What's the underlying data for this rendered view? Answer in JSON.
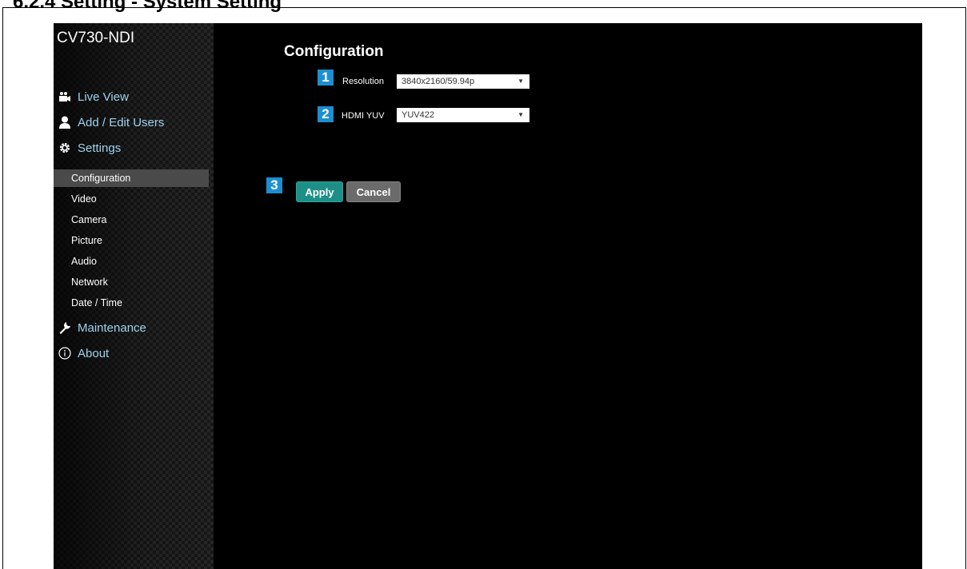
{
  "doc": {
    "heading": "6.2.4 Setting - System Setting"
  },
  "app": {
    "model": "CV730-NDI",
    "nav": [
      {
        "label": "Live View",
        "icon": "video-camera-icon"
      },
      {
        "label": "Add / Edit Users",
        "icon": "user-icon"
      },
      {
        "label": "Settings",
        "icon": "gear-icon"
      }
    ],
    "settings_sub": [
      "Configuration",
      "Video",
      "Camera",
      "Picture",
      "Audio",
      "Network",
      "Date / Time"
    ],
    "nav_bottom": [
      {
        "label": "Maintenance",
        "icon": "wrench-icon"
      },
      {
        "label": "About",
        "icon": "info-icon"
      }
    ],
    "active_item": "Configuration"
  },
  "config": {
    "title": "Configuration",
    "badges": [
      "1",
      "2",
      "3"
    ],
    "resolution": {
      "label": "Resolution",
      "value": "3840x2160/59.94p"
    },
    "hdmi_yuv": {
      "label": "HDMI YUV",
      "value": "YUV422"
    },
    "apply_label": "Apply",
    "cancel_label": "Cancel"
  },
  "colors": {
    "badge": "#1d8fd1",
    "apply": "#1e8f87",
    "cancel": "#6b6b6b",
    "nav_label": "#9fd3ee"
  }
}
